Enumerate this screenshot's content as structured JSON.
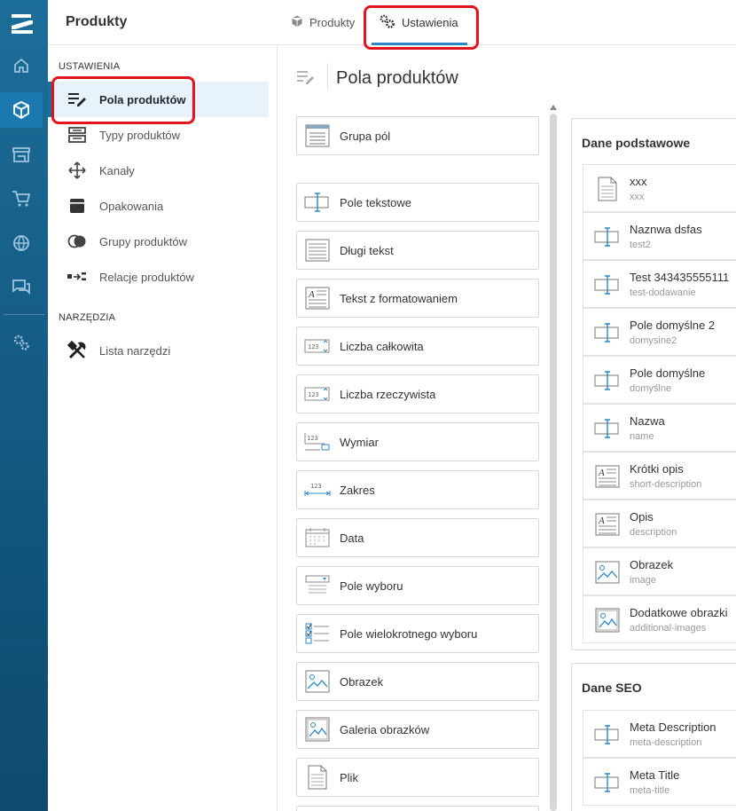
{
  "app": {
    "module_title": "Produkty"
  },
  "tabs": [
    {
      "label": "Produkty",
      "icon": "cube-icon"
    },
    {
      "label": "Ustawienia",
      "icon": "gears-icon",
      "active": true
    }
  ],
  "sidebar": {
    "section_settings": "USTAWIENIA",
    "section_tools": "NARZĘDZIA",
    "items": [
      {
        "label": "Pola produktów",
        "icon": "field-edit-icon",
        "active": true
      },
      {
        "label": "Typy produktów",
        "icon": "product-types-icon"
      },
      {
        "label": "Kanały",
        "icon": "channels-icon"
      },
      {
        "label": "Opakowania",
        "icon": "packaging-icon"
      },
      {
        "label": "Grupy produktów",
        "icon": "product-groups-icon"
      },
      {
        "label": "Relacje produktów",
        "icon": "relations-icon"
      }
    ],
    "tools": [
      {
        "label": "Lista narzędzi",
        "icon": "tools-icon"
      }
    ]
  },
  "main": {
    "title": "Pola produktów",
    "field_types": [
      {
        "label": "Grupa pól",
        "icon": "field-group-icon"
      },
      {
        "label": "Pole tekstowe",
        "icon": "text-field-icon"
      },
      {
        "label": "Długi tekst",
        "icon": "long-text-icon"
      },
      {
        "label": "Tekst z formatowaniem",
        "icon": "rich-text-icon"
      },
      {
        "label": "Liczba całkowita",
        "icon": "integer-icon",
        "icon_text": "123"
      },
      {
        "label": "Liczba rzeczywista",
        "icon": "decimal-icon",
        "icon_text": "123"
      },
      {
        "label": "Wymiar",
        "icon": "dimension-icon",
        "icon_text": "123"
      },
      {
        "label": "Zakres",
        "icon": "range-icon",
        "icon_text": "123"
      },
      {
        "label": "Data",
        "icon": "date-icon"
      },
      {
        "label": "Pole wyboru",
        "icon": "select-icon"
      },
      {
        "label": "Pole wielokrotnego wyboru",
        "icon": "multiselect-icon"
      },
      {
        "label": "Obrazek",
        "icon": "image-icon"
      },
      {
        "label": "Galeria obrazków",
        "icon": "gallery-icon"
      },
      {
        "label": "Plik",
        "icon": "file-icon"
      }
    ],
    "groups": [
      {
        "title": "Dane podstawowe",
        "fields": [
          {
            "name": "xxx",
            "slug": "xxx",
            "icon": "document-icon"
          },
          {
            "name": "Naznwa dsfas",
            "slug": "test2",
            "icon": "text-field-icon"
          },
          {
            "name": "Test 343435555111",
            "slug": "test-dodawanie",
            "icon": "text-field-icon"
          },
          {
            "name": "Pole domyślne 2",
            "slug": "domysine2",
            "icon": "text-field-icon"
          },
          {
            "name": "Pole domyślne",
            "slug": "domyślne",
            "icon": "text-field-icon"
          },
          {
            "name": "Nazwa",
            "slug": "name",
            "icon": "text-field-icon"
          },
          {
            "name": "Krótki opis",
            "slug": "short-description",
            "icon": "rich-text-icon"
          },
          {
            "name": "Opis",
            "slug": "description",
            "icon": "rich-text-icon"
          },
          {
            "name": "Obrazek",
            "slug": "image",
            "icon": "image-icon"
          },
          {
            "name": "Dodatkowe obrazki",
            "slug": "additional-images",
            "icon": "gallery-icon"
          }
        ]
      },
      {
        "title": "Dane SEO",
        "fields": [
          {
            "name": "Meta Description",
            "slug": "meta-description",
            "icon": "text-field-icon"
          },
          {
            "name": "Meta Title",
            "slug": "meta-title",
            "icon": "text-field-icon"
          }
        ]
      }
    ]
  },
  "colors": {
    "accent": "#2b86c5",
    "rail": "#135a82",
    "highlight": "#e2141e"
  }
}
